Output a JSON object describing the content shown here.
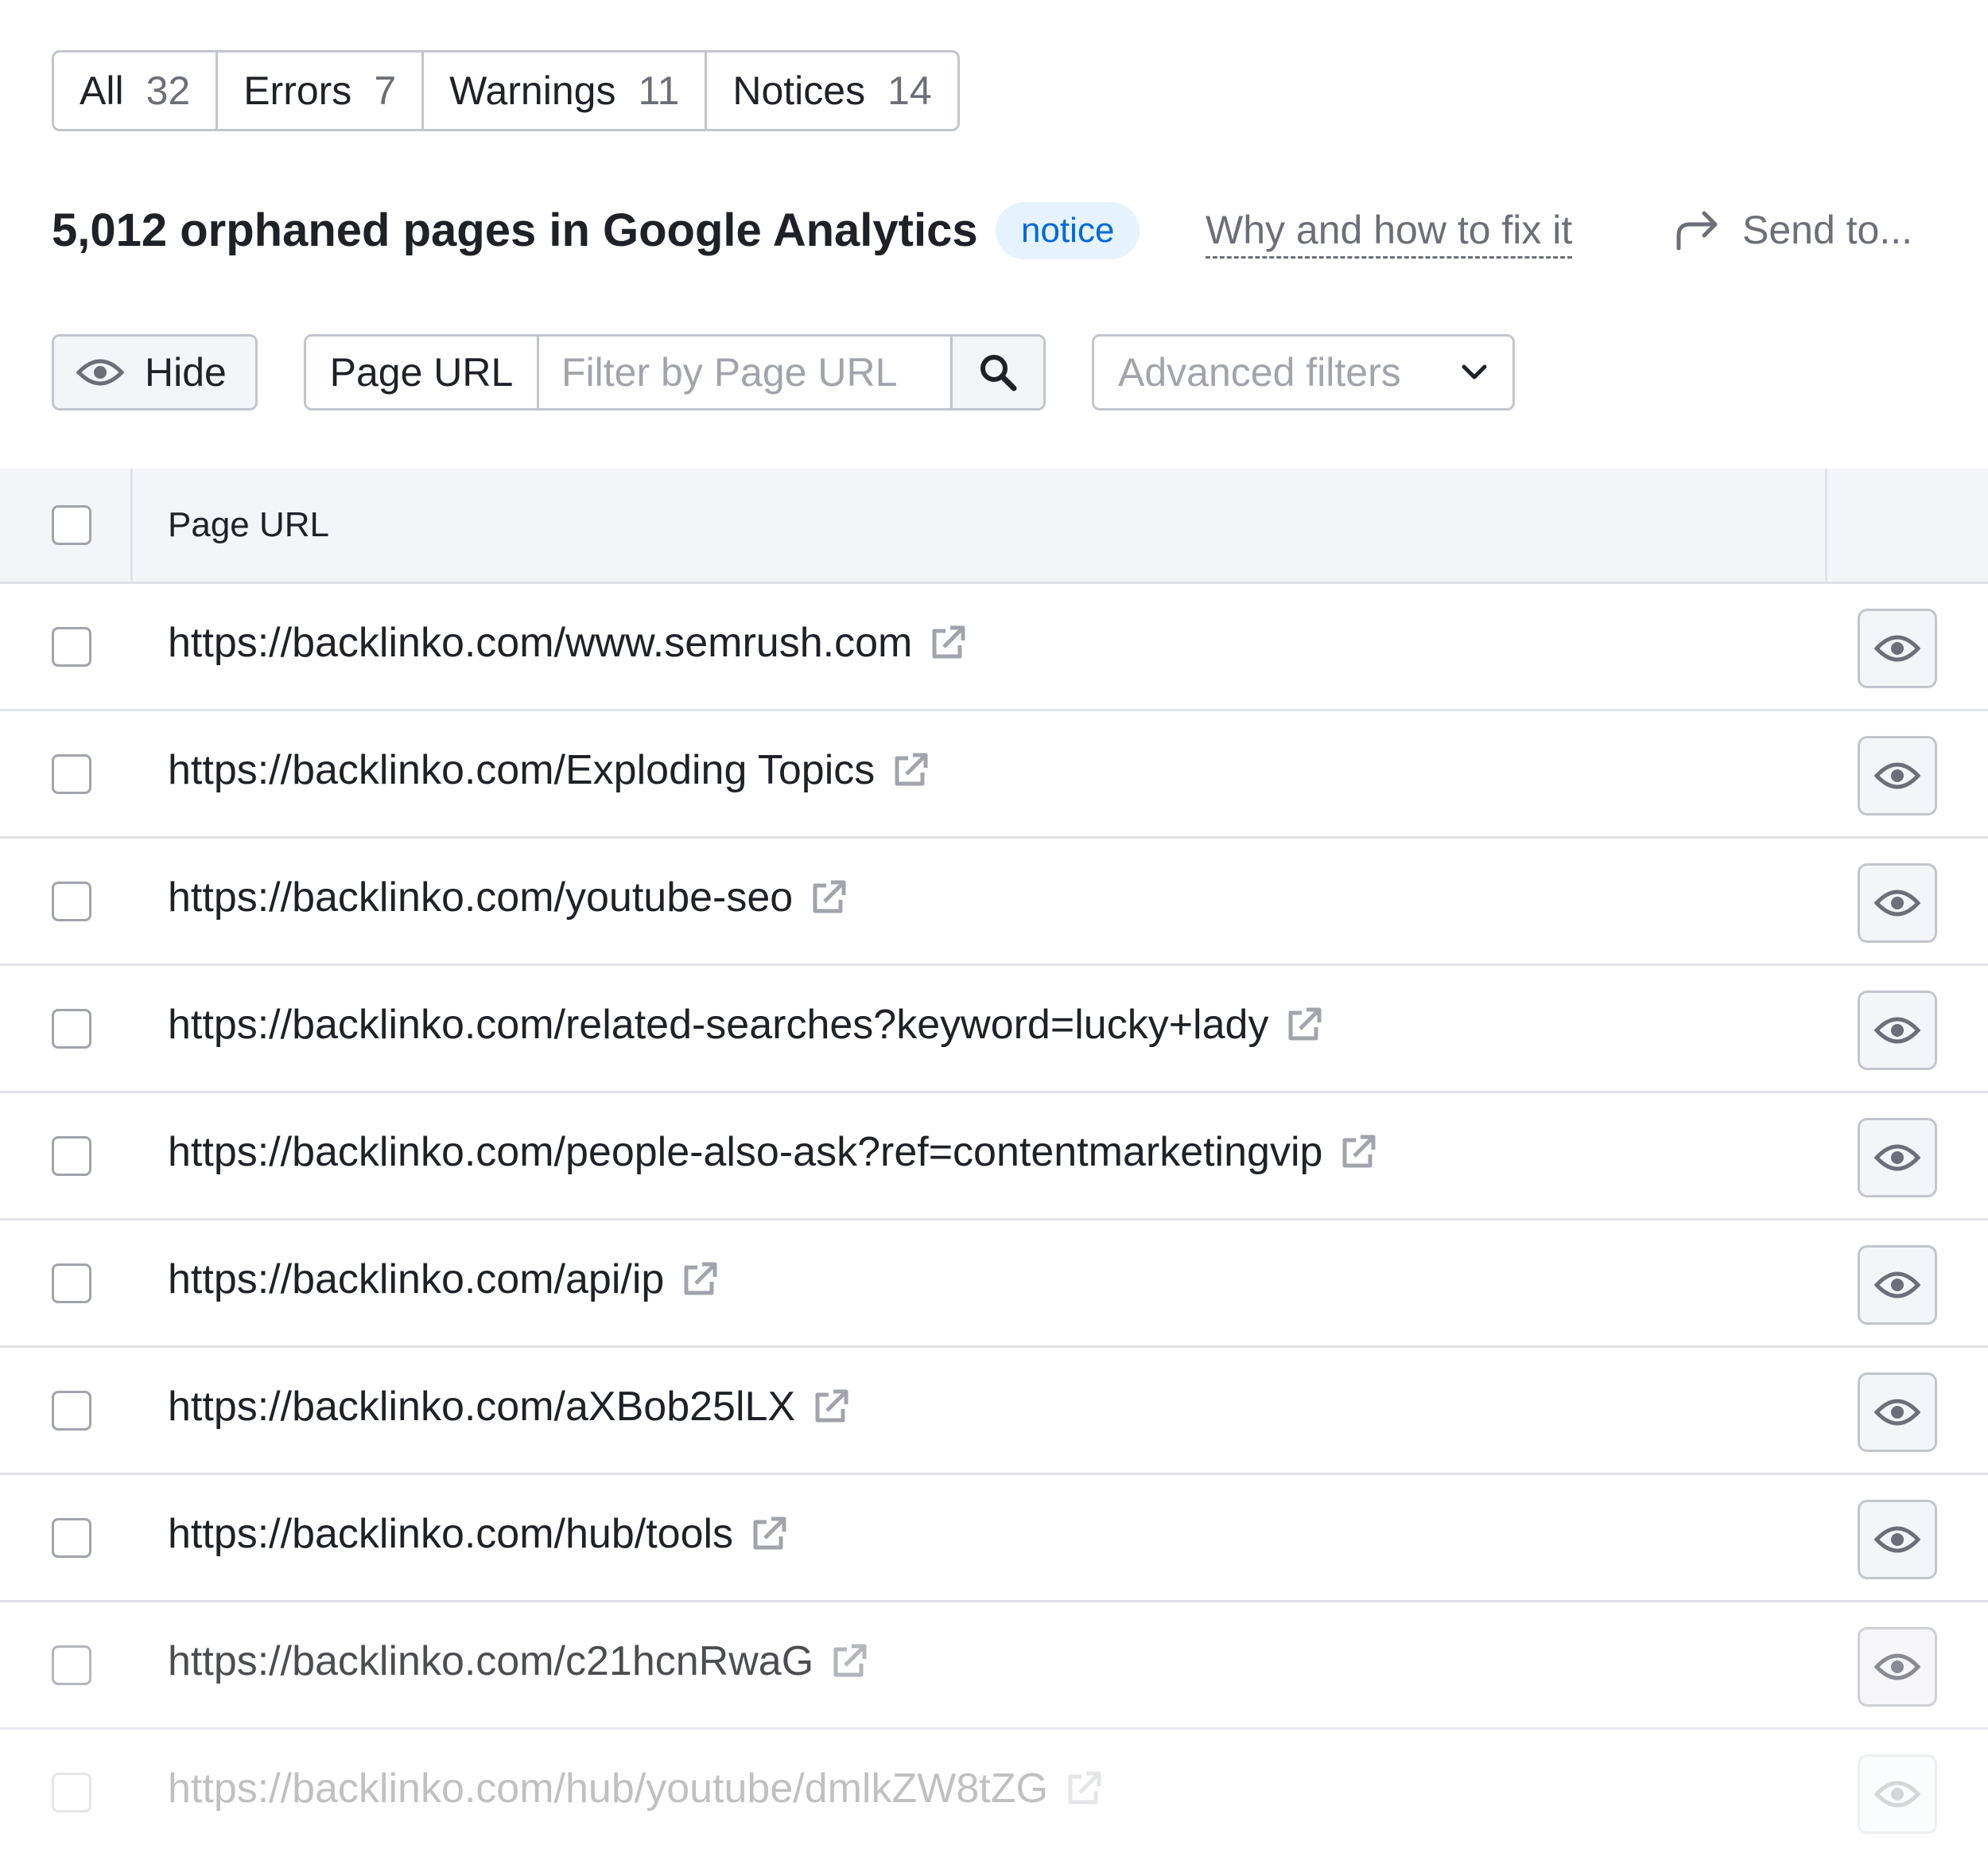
{
  "tabs": [
    {
      "label": "All",
      "count": "32"
    },
    {
      "label": "Errors",
      "count": "7"
    },
    {
      "label": "Warnings",
      "count": "11"
    },
    {
      "label": "Notices",
      "count": "14"
    }
  ],
  "issue": {
    "title": "5,012 orphaned pages in Google Analytics",
    "badge": "notice",
    "why_link": "Why and how to fix it",
    "send_label": "Send to..."
  },
  "filters": {
    "hide_label": "Hide",
    "url_label": "Page URL",
    "url_placeholder": "Filter by Page URL",
    "advanced_label": "Advanced filters"
  },
  "table": {
    "header": "Page URL",
    "rows": [
      "https://backlinko.com/www.semrush.com",
      "https://backlinko.com/Exploding Topics",
      "https://backlinko.com/youtube-seo",
      "https://backlinko.com/related-searches?keyword=lucky+lady",
      "https://backlinko.com/people-also-ask?ref=contentmarketingvip",
      "https://backlinko.com/api/ip",
      "https://backlinko.com/aXBob25lLX",
      "https://backlinko.com/hub/tools",
      "https://backlinko.com/c21hcnRwaG",
      "https://backlinko.com/hub/youtube/dmlkZW8tZG"
    ]
  },
  "icons": {
    "eye": "eye-icon",
    "search": "search-icon",
    "chevron": "chevron-down-icon",
    "share": "share-arrow-icon",
    "external": "external-link-icon"
  },
  "colors": {
    "accent_blue": "#0069d4",
    "badge_bg": "#e6f2fd",
    "border": "#c2c5cd",
    "muted_text": "#6c6e79",
    "header_bg": "#f4f5f9"
  }
}
